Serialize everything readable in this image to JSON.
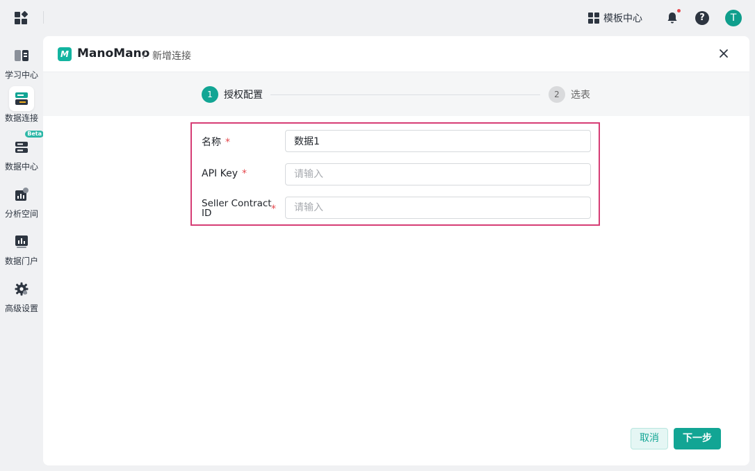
{
  "topbar": {
    "template_center_label": "模板中心",
    "avatar_initial": "T",
    "help_glyph": "?"
  },
  "sidebar": {
    "items": [
      {
        "label": "学习中心",
        "icon": "book-icon"
      },
      {
        "label": "数据连接",
        "icon": "database-link-icon",
        "active": true
      },
      {
        "label": "数据中心",
        "icon": "server-icon",
        "badge": "Beta"
      },
      {
        "label": "分析空间",
        "icon": "chart-folder-icon"
      },
      {
        "label": "数据门户",
        "icon": "portal-chart-icon"
      },
      {
        "label": "高级设置",
        "icon": "gear-icon"
      }
    ]
  },
  "dialog": {
    "logo_letter": "M",
    "brand_name": "ManoMano",
    "breadcrumb_sep": "/",
    "breadcrumb_current": "新增连接",
    "steps": [
      {
        "num": "1",
        "label": "授权配置",
        "active": true
      },
      {
        "num": "2",
        "label": "选表",
        "active": false
      }
    ],
    "fields": [
      {
        "label": "名称",
        "required_mark": "*",
        "value": "数据1",
        "placeholder": ""
      },
      {
        "label": "API Key",
        "required_mark": "*",
        "value": "",
        "placeholder": "请输入"
      },
      {
        "label": "Seller Contract ID",
        "required_mark": "*",
        "value": "",
        "placeholder": "请输入"
      }
    ],
    "cancel_label": "取消",
    "next_label": "下一步"
  },
  "colors": {
    "accent": "#12a594",
    "highlight_border": "#d63c74",
    "required": "#e5484d"
  }
}
